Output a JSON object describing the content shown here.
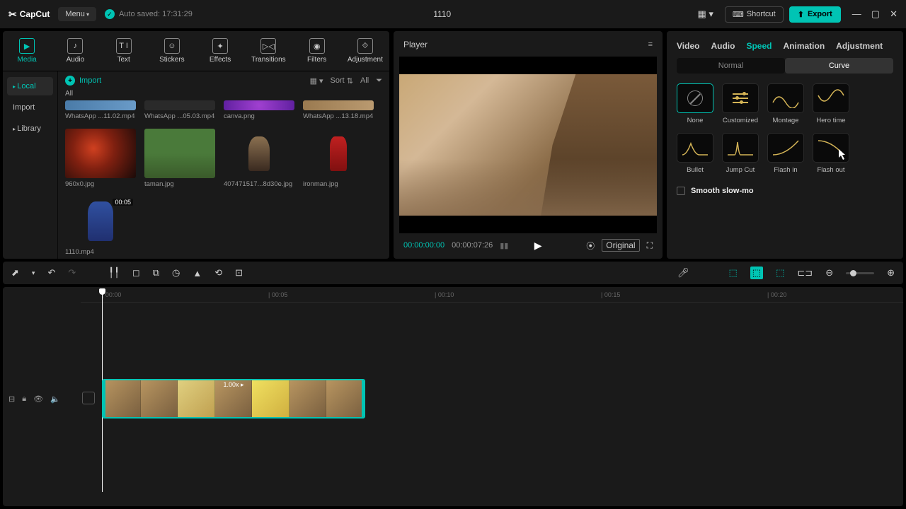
{
  "app": {
    "name": "CapCut",
    "menu": "Menu",
    "autosave": "Auto saved: 17:31:29",
    "project": "1110"
  },
  "titlebar": {
    "shortcut": "Shortcut",
    "export": "Export"
  },
  "topTabs": [
    {
      "label": "Media",
      "active": true
    },
    {
      "label": "Audio"
    },
    {
      "label": "Text"
    },
    {
      "label": "Stickers"
    },
    {
      "label": "Effects"
    },
    {
      "label": "Transitions"
    },
    {
      "label": "Filters"
    },
    {
      "label": "Adjustment"
    }
  ],
  "sideNav": [
    {
      "label": "Local",
      "expand": true,
      "active": true
    },
    {
      "label": "Import",
      "active": false
    },
    {
      "label": "Library",
      "expand": true
    }
  ],
  "mediaToolbar": {
    "import": "Import",
    "sort": "Sort",
    "all": "All",
    "allLabel": "All"
  },
  "thumbs": [
    {
      "name": "WhatsApp ...11.02.mp4",
      "partial": true,
      "bg": "linear-gradient(90deg,#4a7ba8,#6a9bc8)"
    },
    {
      "name": "WhatsApp ...05.03.mp4",
      "partial": true,
      "bg": "#2a2a2a"
    },
    {
      "name": "canva.png",
      "partial": true,
      "bg": "radial-gradient(circle,#a040d0,#6020a0)"
    },
    {
      "name": "WhatsApp ...13.18.mp4",
      "partial": true,
      "bg": "linear-gradient(90deg,#9a7a50,#ba9a70)"
    },
    {
      "name": "960x0.jpg",
      "bg": "radial-gradient(circle at 40% 40%,#d04020,#802010 40%,#1a0a08)"
    },
    {
      "name": "taman.jpg",
      "bg": "linear-gradient(180deg,#4a7a3a 50%,#3a5a2a)"
    },
    {
      "name": "407471517...8d30e.jpg",
      "bg": "#1a1a1a",
      "figure": "thor"
    },
    {
      "name": "ironman.jpg",
      "bg": "#1a1a1a",
      "figure": "ironman"
    },
    {
      "name": "1110.mp4",
      "dur": "00:05",
      "bg": "#1a1a1a",
      "figure": "cap"
    }
  ],
  "player": {
    "title": "Player",
    "cur": "00:00:00:00",
    "dur": "00:00:07:26",
    "original": "Original"
  },
  "inspector": {
    "tabs": [
      "Video",
      "Audio",
      "Speed",
      "Animation",
      "Adjustment"
    ],
    "activeTab": "Speed",
    "subtabs": [
      "Normal",
      "Curve"
    ],
    "activeSub": "Curve",
    "curves": [
      "None",
      "Customized",
      "Montage",
      "Hero time",
      "Bullet",
      "Jump Cut",
      "Flash in",
      "Flash out"
    ],
    "selected": "None",
    "smooth": "Smooth slow-mo"
  },
  "ruler": [
    "00:00",
    "00:05",
    "00:10",
    "00:15",
    "00:20"
  ],
  "clip": {
    "label": "1.00x ▸"
  }
}
